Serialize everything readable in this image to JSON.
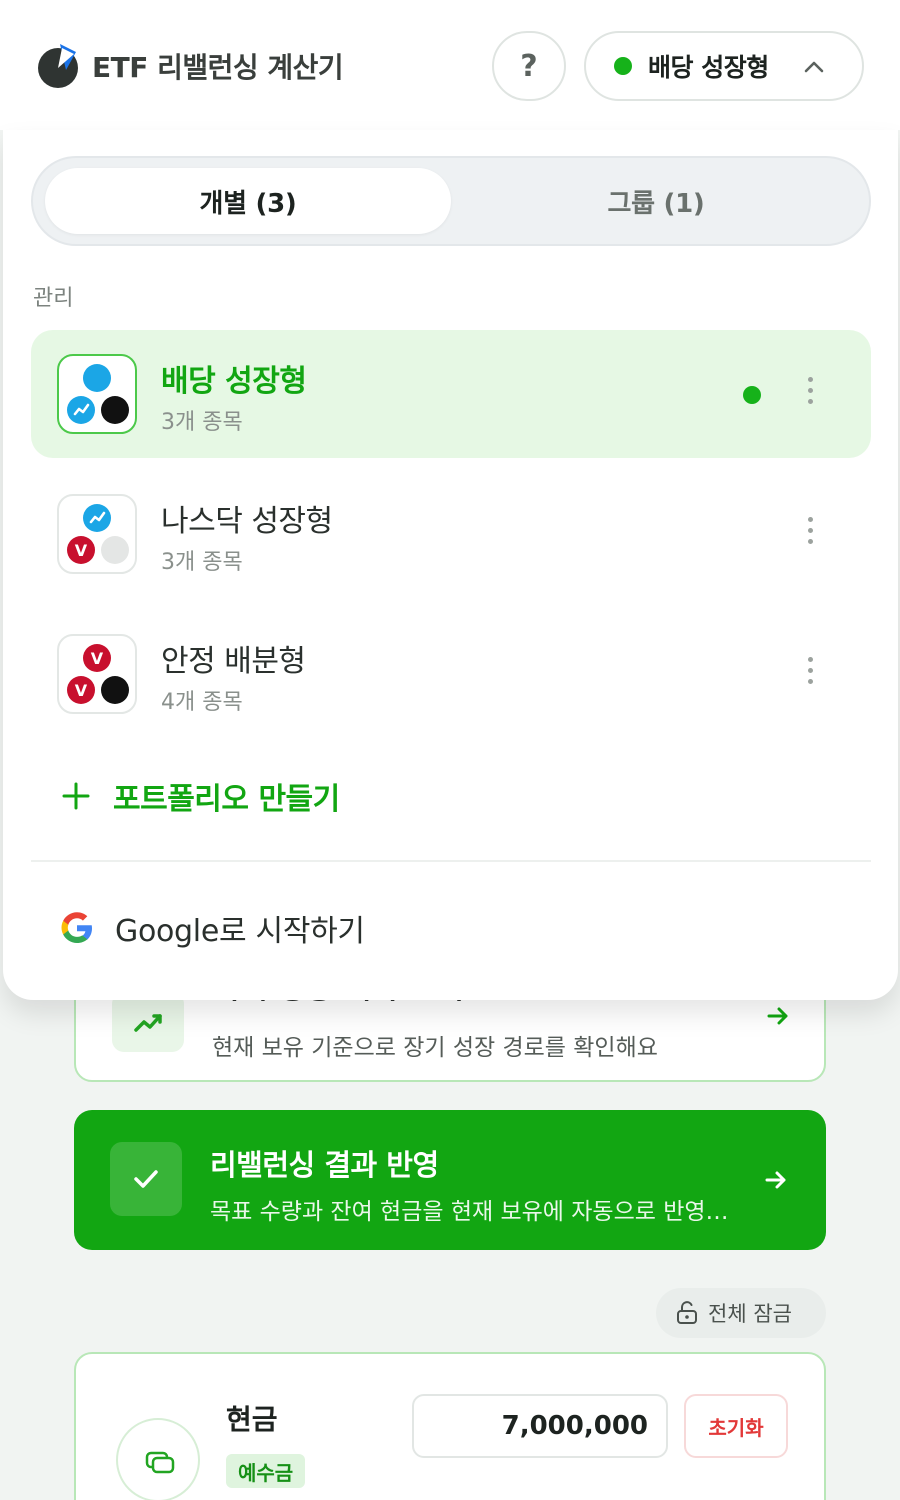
{
  "header": {
    "app_title": "ETF 리밸런싱 계산기",
    "help_label": "?",
    "current_portfolio": "배당 성장형"
  },
  "menu": {
    "tabs": [
      {
        "label": "개별 (3)",
        "active": true
      },
      {
        "label": "그룹 (1)",
        "active": false
      }
    ],
    "section_label": "관리",
    "portfolios": [
      {
        "name": "배당 성장형",
        "count": "3개 종목",
        "active": true,
        "icons": [
          "blue",
          "blue-chart",
          "black"
        ]
      },
      {
        "name": "나스닥 성장형",
        "count": "3개 종목",
        "active": false,
        "icons": [
          "blue-chart",
          "red-v",
          "grey"
        ]
      },
      {
        "name": "안정 배분형",
        "count": "4개 종목",
        "active": false,
        "icons": [
          "red-v",
          "red-v",
          "black"
        ]
      }
    ],
    "create_label": "포트폴리오 만들기",
    "google_label": "Google로 시작하기"
  },
  "background": {
    "forecast_title": "미래 성장 예측 보기",
    "forecast_subtitle": "현재 보유 기준으로 장기 성장 경로를 확인해요",
    "apply_title": "리밸런싱 결과 반영",
    "apply_subtitle": "목표 수량과 잔여 현금을 현재 보유에 자동으로 반영해요",
    "lock_all_label": "전체 잠금",
    "cash_title": "현금",
    "cash_badge": "예수금",
    "cash_amount": "7,000,000",
    "reset_label": "초기화"
  },
  "colors": {
    "accent_green": "#12a612",
    "active_dot": "#16b21a",
    "active_bg": "#e6f8e4",
    "danger_red": "#e23838"
  }
}
